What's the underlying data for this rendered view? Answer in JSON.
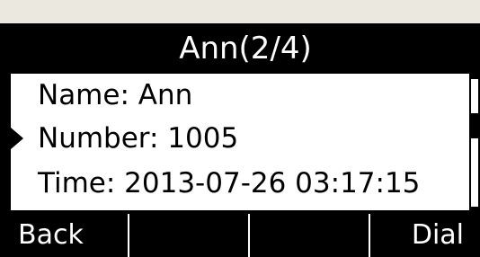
{
  "header": {
    "title": "Ann(2/4)"
  },
  "details": {
    "name": "Name: Ann",
    "number": "Number: 1005",
    "time": "Time: 2013-07-26 03:17:15",
    "selected_row": "number"
  },
  "scrollbar": {
    "position_fraction": 0.33
  },
  "softkeys": [
    "Back",
    "",
    "",
    "Dial"
  ],
  "colors": {
    "screen_bg": "#000000",
    "content_bg": "#ffffff",
    "window_bg": "#ebe8df"
  }
}
